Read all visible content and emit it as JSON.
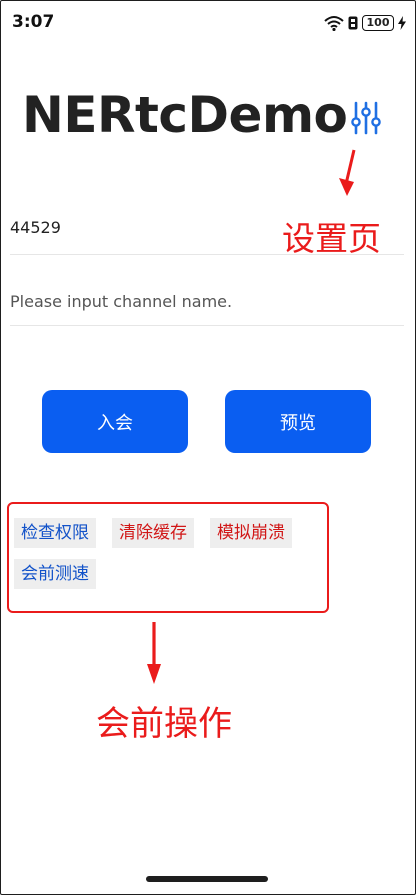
{
  "status_bar": {
    "time": "3:07",
    "battery": "100"
  },
  "app": {
    "title": "NERtcDemo"
  },
  "inputs": {
    "channel_value": "44529",
    "name_placeholder": "Please input channel name."
  },
  "buttons": {
    "join": "入会",
    "preview": "预览"
  },
  "pre_meeting_ops": [
    {
      "label": "检查权限",
      "color": "#1252c9"
    },
    {
      "label": "清除缓存",
      "color": "#d11717"
    },
    {
      "label": "模拟崩溃",
      "color": "#d11717"
    },
    {
      "label": "会前测速",
      "color": "#1252c9"
    }
  ],
  "annotations": {
    "settings_page": "设置页",
    "pre_meeting_ops": "会前操作"
  },
  "colors": {
    "primary": "#0a5ef1",
    "annotation": "#ea1b1b",
    "settings_icon": "#1f6fe3"
  },
  "icons": {
    "settings": "settings-sliders-icon",
    "wifi": "wifi-icon",
    "notification": "notification-icon",
    "charging": "charging-bolt-icon"
  }
}
